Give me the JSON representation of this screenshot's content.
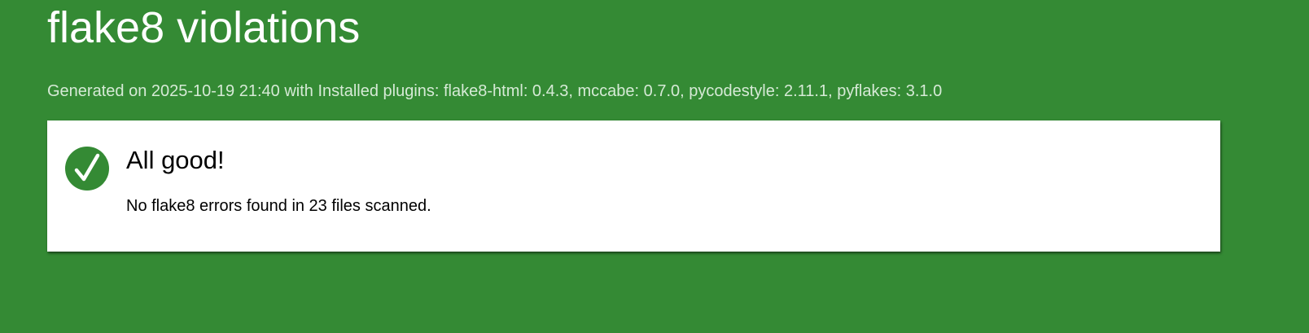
{
  "header": {
    "title": "flake8 violations",
    "subtitle": "Generated on 2025-10-19 21:40 with Installed plugins: flake8-html: 0.4.3, mccabe: 0.7.0, pycodestyle: 2.11.1, pyflakes: 3.1.0"
  },
  "result_card": {
    "icon": "check-circle-icon",
    "title": "All good!",
    "message": "No flake8 errors found in 23 files scanned."
  },
  "colors": {
    "background": "#348a34",
    "card": "#ffffff",
    "icon_fill": "#348a34"
  }
}
